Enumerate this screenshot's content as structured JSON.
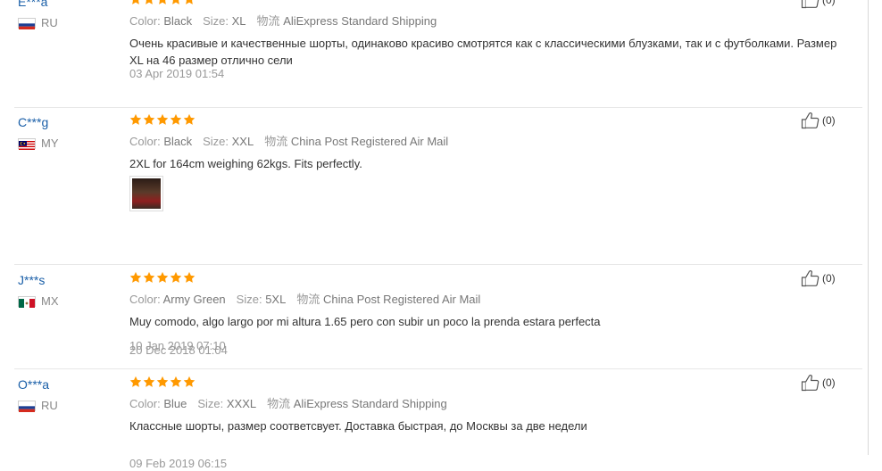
{
  "reviews": [
    {
      "user": "E***a",
      "country": "RU",
      "flag": "ru",
      "stars": 5,
      "color_label": "Color:",
      "color_value": "Black",
      "size_label": "Size:",
      "size_value": "XL",
      "shipping_label": "物流",
      "shipping_value": "AliExpress Standard Shipping",
      "feedback": "Очень красивые и качественные шорты, одинаково красиво смотрятся как с классическими блузками, так и с футболками. Размер XL на 46 размер отлично сели",
      "date": "03 Apr 2019 01:54",
      "has_photo": false,
      "likes": "(0)"
    },
    {
      "user": "C***g",
      "country": "MY",
      "flag": "my",
      "stars": 5,
      "color_label": "Color:",
      "color_value": "Black",
      "size_label": "Size:",
      "size_value": "XXL",
      "shipping_label": "物流",
      "shipping_value": "China Post Registered Air Mail",
      "feedback": "2XL for 164cm weighing 62kgs. Fits perfectly.",
      "date": "20 Dec 2018 01:04",
      "has_photo": true,
      "likes": "(0)"
    },
    {
      "user": "J***s",
      "country": "MX",
      "flag": "mx",
      "stars": 5,
      "color_label": "Color:",
      "color_value": "Army Green",
      "size_label": "Size:",
      "size_value": "5XL",
      "shipping_label": "物流",
      "shipping_value": "China Post Registered Air Mail",
      "feedback": "Muy comodo, algo largo por mi altura 1.65 pero con subir un poco la prenda estara perfecta",
      "date": "10 Jan 2019 07:10",
      "has_photo": false,
      "likes": "(0)"
    },
    {
      "user": "O***a",
      "country": "RU",
      "flag": "ru",
      "stars": 5,
      "color_label": "Color:",
      "color_value": "Blue",
      "size_label": "Size:",
      "size_value": "XXXL",
      "shipping_label": "物流",
      "shipping_value": "AliExpress Standard Shipping",
      "feedback": "Классные шорты, размер соответсвует. Доставка быстрая, до Москвы за две недели",
      "date": "09 Feb 2019 06:15",
      "has_photo": false,
      "likes": "(0)"
    }
  ],
  "colors": {
    "star": "#ff9900",
    "username": "#1a5fa8",
    "muted": "#999999",
    "text": "#333333"
  },
  "icons": {
    "like": "thumbs-up-icon",
    "star": "star-icon"
  }
}
